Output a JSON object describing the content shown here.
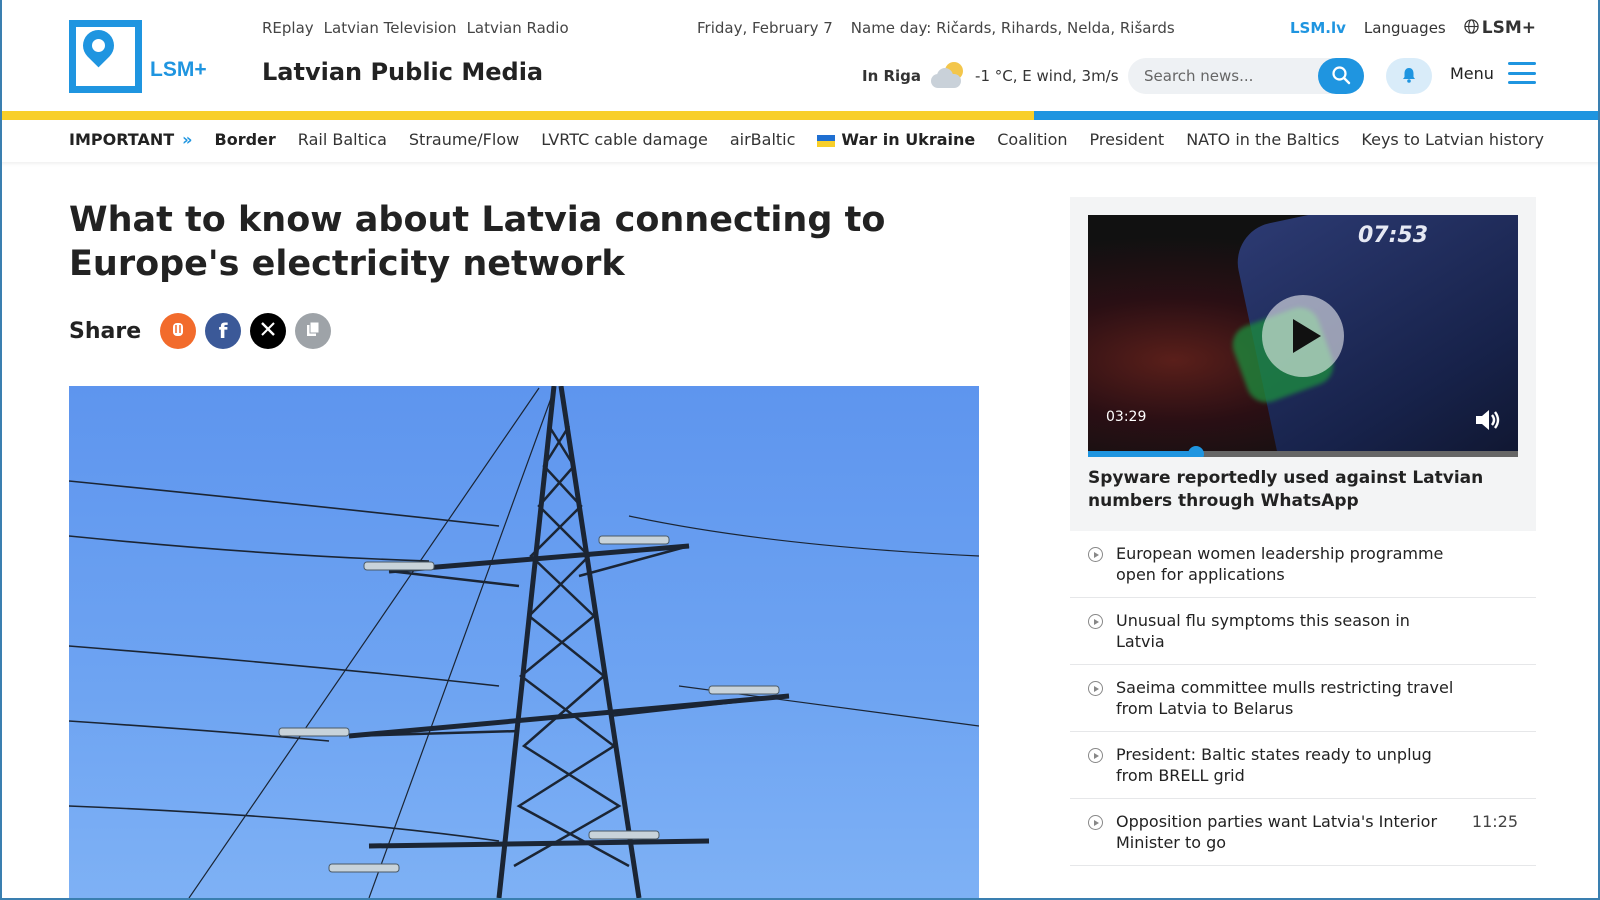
{
  "header": {
    "logo_text": "LSM+",
    "top_links": [
      "REplay",
      "Latvian Television",
      "Latvian Radio"
    ],
    "site_title": "Latvian Public Media",
    "date": "Friday, February 7",
    "name_day": "Name day: Ričards, Rihards, Nelda, Rišards",
    "lsm_lv": "LSM.lv",
    "languages": "Languages",
    "lsm_plus": "LSM+",
    "weather_city": "In Riga",
    "weather": "-1 °C, E wind, 3m/s",
    "search_placeholder": "Search news...",
    "menu_label": "Menu"
  },
  "nav": {
    "important": "IMPORTANT",
    "items": [
      "Border",
      "Rail Baltica",
      "Straume/Flow",
      "LVRTC cable damage",
      "airBaltic",
      "War in Ukraine",
      "Coalition",
      "President",
      "NATO in the Baltics",
      "Keys to Latvian history"
    ]
  },
  "article": {
    "headline": "What to know about Latvia connecting to Europe's electricity network",
    "share_label": "Share"
  },
  "sidebar": {
    "video": {
      "duration": "03:29",
      "progress": 0.25,
      "title": "Spyware reportedly used against Latvian numbers through WhatsApp"
    },
    "news": [
      {
        "title": "European women leadership programme open for applications",
        "time": ""
      },
      {
        "title": "Unusual flu symptoms this season in Latvia",
        "time": ""
      },
      {
        "title": "Saeima committee mulls restricting travel from Latvia to Belarus",
        "time": ""
      },
      {
        "title": "President: Baltic states ready to unplug from BRELL grid",
        "time": ""
      },
      {
        "title": "Opposition parties want Latvia's Interior Minister to go",
        "time": "11:25"
      }
    ]
  },
  "colors": {
    "brand_blue": "#1f95e0",
    "flag_yellow": "#f8cf2a",
    "sky": "#6ea4f2"
  }
}
